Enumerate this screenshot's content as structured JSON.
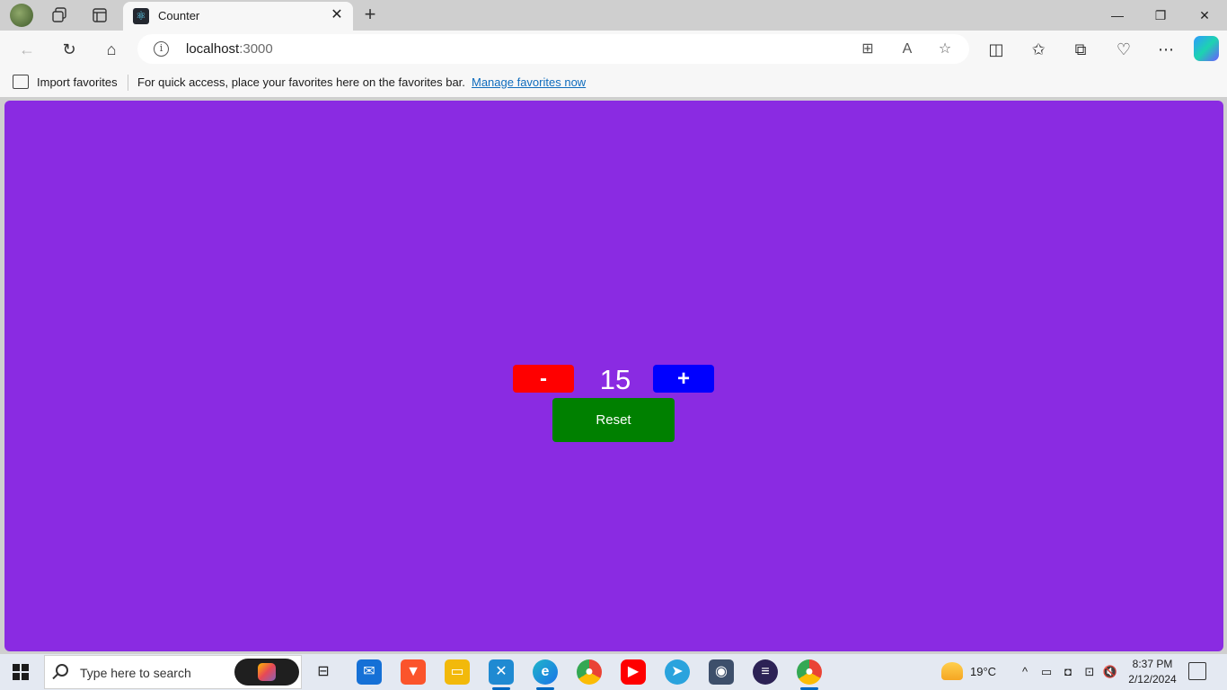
{
  "browser": {
    "tab_title": "Counter",
    "tab_icon": "react-icon",
    "address": {
      "host": "localhost",
      "port": ":3000"
    },
    "favorites": {
      "import_label": "Import favorites",
      "message": "For quick access, place your favorites here on the favorites bar.",
      "manage_link": "Manage favorites now"
    }
  },
  "counter": {
    "decrement_label": "-",
    "value": "15",
    "increment_label": "+",
    "reset_label": "Reset",
    "colors": {
      "background": "#8a2be2",
      "decrement": "#ff0000",
      "increment": "#0000ff",
      "reset": "#008000"
    }
  },
  "taskbar": {
    "search_placeholder": "Type here to search",
    "apps": [
      "copilot",
      "task-view",
      "mail",
      "brave",
      "file-explorer",
      "vscode",
      "edge",
      "chrome",
      "youtube",
      "telegram",
      "disk-utility",
      "eclipse",
      "chrome-profile"
    ],
    "weather": "19°C",
    "time": "8:37 PM",
    "date": "2/12/2024"
  }
}
